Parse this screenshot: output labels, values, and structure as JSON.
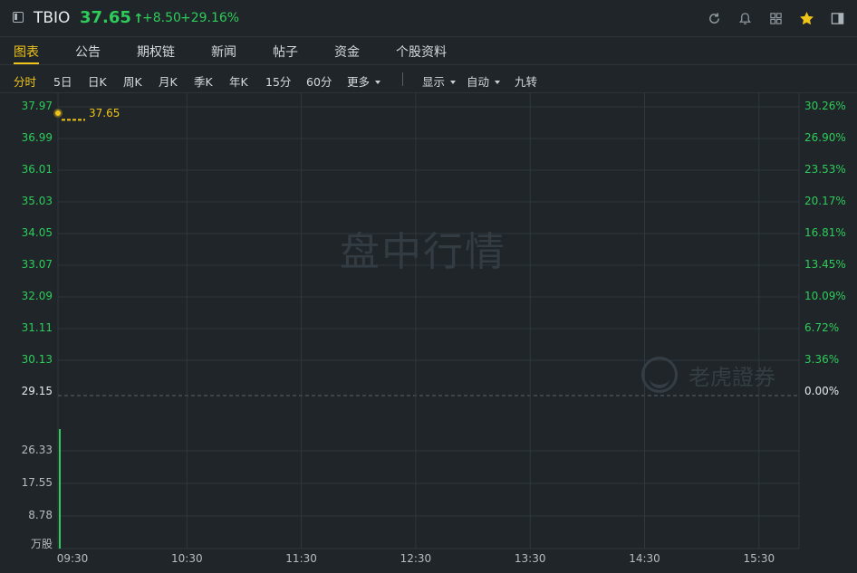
{
  "header": {
    "ticker": "TBIO",
    "price": "37.65",
    "arrow": "↑",
    "change": "+8.50",
    "change_pct": "+29.16%",
    "icons": [
      "refresh-icon",
      "bell-icon",
      "grid-icon",
      "star-icon",
      "panel-icon"
    ]
  },
  "tabs": [
    "图表",
    "公告",
    "期权链",
    "新闻",
    "帖子",
    "资金",
    "个股资料"
  ],
  "active_tab": "图表",
  "periods": [
    "分时",
    "5日",
    "日K",
    "周K",
    "月K",
    "季K",
    "年K",
    "15分",
    "60分"
  ],
  "active_period": "分时",
  "more_label": "更多",
  "display_label": "显示",
  "auto_label": "自动",
  "rights_label": "九转",
  "chart_data": {
    "type": "line",
    "price_axis_left": [
      "37.97",
      "36.99",
      "36.01",
      "35.03",
      "34.05",
      "33.07",
      "32.09",
      "31.11",
      "30.13",
      "29.15"
    ],
    "price_axis_right": [
      "30.26%",
      "26.90%",
      "23.53%",
      "20.17%",
      "16.81%",
      "13.45%",
      "10.09%",
      "6.72%",
      "3.36%",
      "0.00%"
    ],
    "prev_close": 29.15,
    "current_price_label": "37.65",
    "series": [
      {
        "x": [
          "09:30"
        ],
        "values": [
          37.65
        ]
      }
    ],
    "volume_axis": [
      "26.33",
      "17.55",
      "8.78"
    ],
    "volume_unit": "万股",
    "volume_series": [
      {
        "x": [
          "09:30"
        ],
        "values": [
          26.33
        ]
      }
    ],
    "x_ticks": [
      "09:30",
      "10:30",
      "11:30",
      "12:30",
      "13:30",
      "14:30",
      "15:30"
    ],
    "ylim": [
      29.15,
      37.97
    ],
    "volume_ylim": [
      0,
      26.33
    ],
    "grid": true
  },
  "watermark": "盘中行情",
  "brand": "老虎證券",
  "colors": {
    "up": "#2ecc5a",
    "accent": "#f0c419",
    "grid": "#2f383d",
    "background": "#1f2529"
  }
}
